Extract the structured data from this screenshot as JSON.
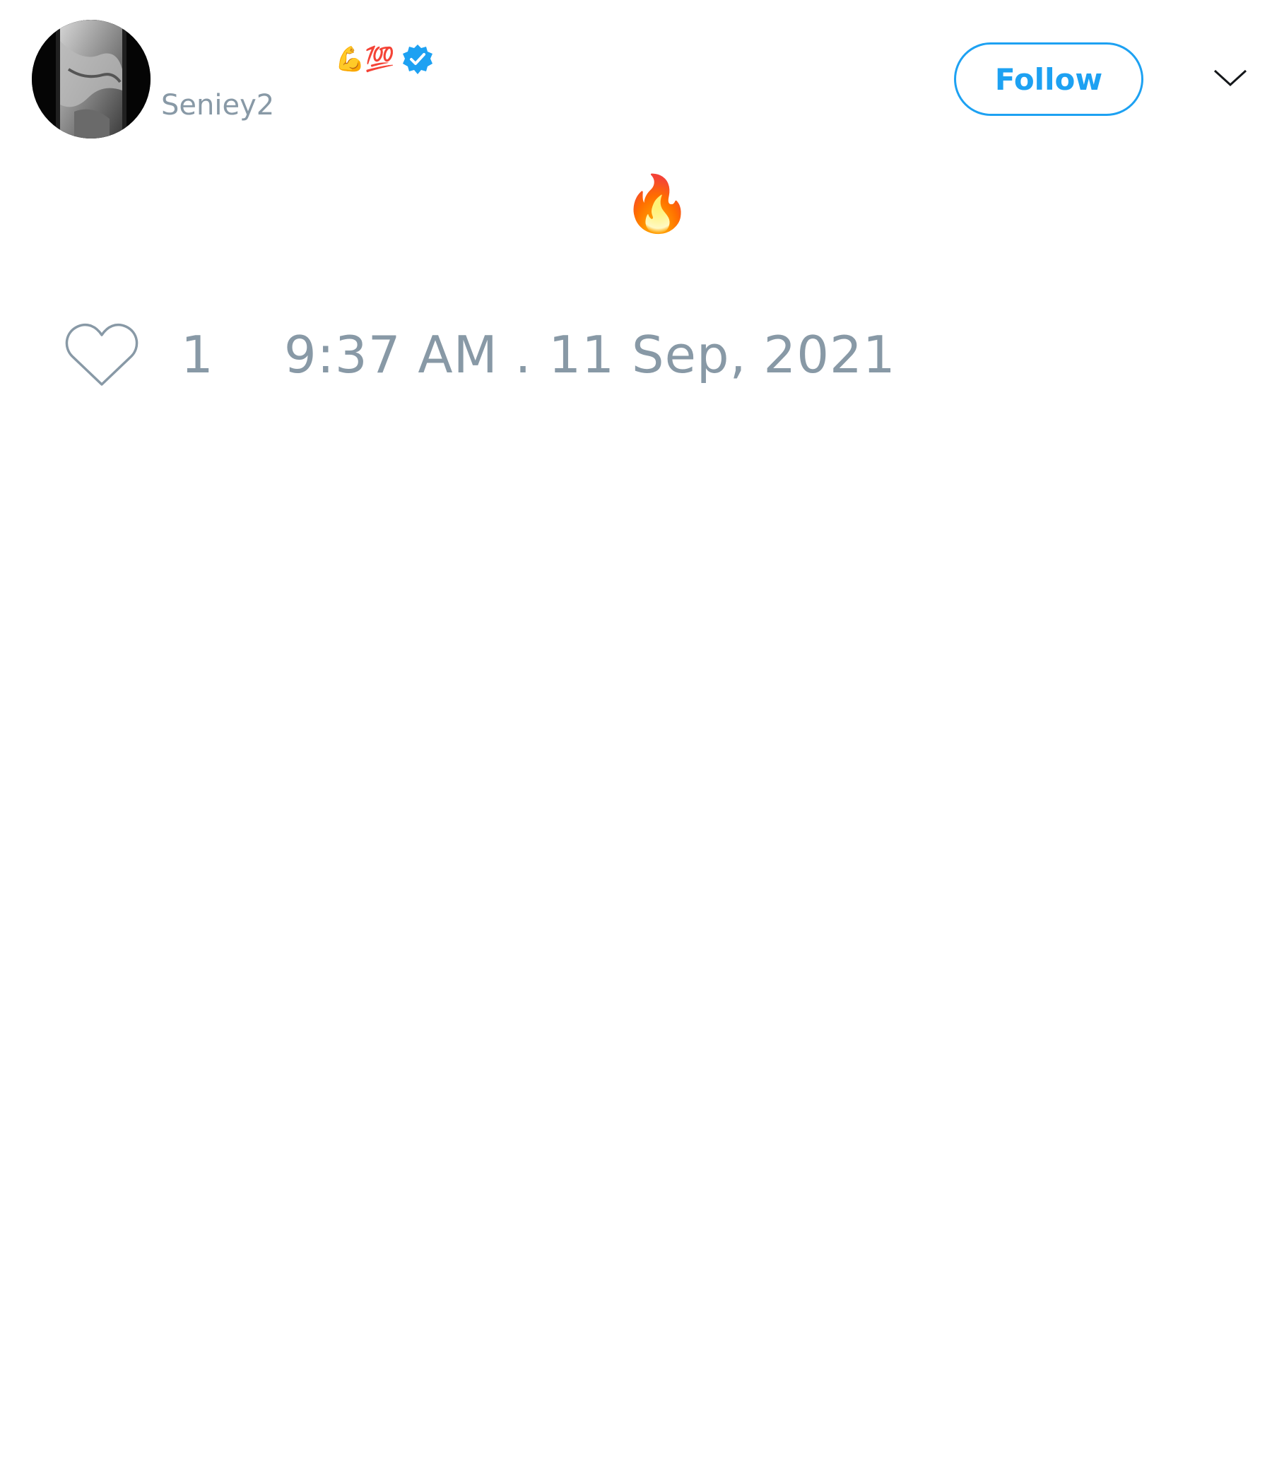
{
  "tweet": {
    "author": {
      "display_name": "",
      "name_emoji": "💪💯",
      "handle": "Seniey2",
      "verified": true,
      "avatar_icon": "profile-photo"
    },
    "follow_label": "Follow",
    "menu_icon": "chevron-down-icon",
    "text": "🔥",
    "likes": "1",
    "timestamp": "9:37 AM . 11 Sep, 2021"
  },
  "colors": {
    "accent": "#1da1f2",
    "muted": "#8899a6",
    "background": "#ffffff"
  }
}
